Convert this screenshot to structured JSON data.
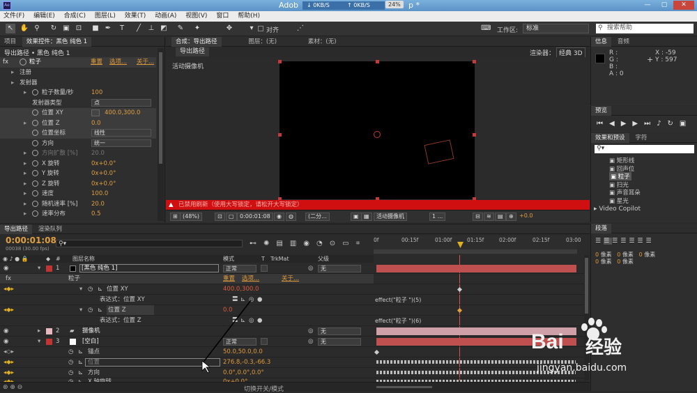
{
  "titlebar": {
    "app": "Adob",
    "net_down": "0KB/S",
    "net_up": "0KB/S",
    "net_pct": "24%",
    "title_rest": "p *",
    "min": "—",
    "max": "▢",
    "close": "✕"
  },
  "menu": [
    "文件(F)",
    "编辑(E)",
    "合成(C)",
    "图层(L)",
    "效果(T)",
    "动画(A)",
    "视图(V)",
    "窗口",
    "帮助(H)"
  ],
  "toolbar": {
    "align_label": "对齐",
    "workspace_label": "工作区:",
    "workspace_value": "标准",
    "search_placeholder": "搜索帮助"
  },
  "effect_controls": {
    "tabs": [
      "项目",
      "效果控件：黑色 纯色 1"
    ],
    "breadcrumb": "导出路径 • 黑色 纯色 1",
    "effect_name": "粒子",
    "reset": "重置",
    "options": "选项...",
    "about": "关于...",
    "rows": [
      {
        "label": "注册",
        "val": ""
      },
      {
        "label": "发射器",
        "val": ""
      },
      {
        "label": "粒子数量/秒",
        "val": "100"
      },
      {
        "label": "发射器类型",
        "val": "点",
        "dd": true
      },
      {
        "label": "位置 XY",
        "val": "400.0,300.0"
      },
      {
        "label": "位置 Z",
        "val": "0.0"
      },
      {
        "label": "位置坐标",
        "val": "线性",
        "dd": true
      },
      {
        "label": "方向",
        "val": "统一",
        "dd": true
      },
      {
        "label": "方向扩散 [%]",
        "val": "20.0"
      },
      {
        "label": "X 旋转",
        "val": "0x+0.0°"
      },
      {
        "label": "Y 旋转",
        "val": "0x+0.0°"
      },
      {
        "label": "Z 旋转",
        "val": "0x+0.0°"
      },
      {
        "label": "速度",
        "val": "100.0"
      },
      {
        "label": "随机速率 [%]",
        "val": "20.0"
      },
      {
        "label": "速率分布",
        "val": "0.5"
      }
    ]
  },
  "composition": {
    "tabs": [
      "合成：导出路径",
      "图层：(无)",
      "素材：(无)"
    ],
    "subtab": "导出路径",
    "renderer_label": "渲染器：",
    "renderer_value": "经典 3D",
    "camera_label": "活动摄像机",
    "warning": "已禁用刷新（使用大写锁定，请松开大写锁定）",
    "zoom": "(48%)",
    "timecode": "0:00:01:08",
    "resolution": "(二分...",
    "view_camera": "活动摄像机",
    "views": "1 ...",
    "exposure": "+0.0"
  },
  "info": {
    "tabs": [
      "信息",
      "音频"
    ],
    "r": "R :",
    "g": "G :",
    "b": "B :",
    "a": "A : 0",
    "x": "X : -59",
    "y": "Y : 597"
  },
  "preview": {
    "tab": "预览"
  },
  "effects_presets": {
    "tabs": [
      "效果和预设",
      "字符"
    ],
    "items": [
      "矩形线",
      "回声位",
      "粒子",
      "扫光",
      "声音耳朵",
      "星光"
    ],
    "folder": "Video Copilot"
  },
  "paragraph": {
    "tab": "段落",
    "unit": "像素",
    "val": "0"
  },
  "timeline": {
    "tabs": [
      "导出路径",
      "渲染队列"
    ],
    "timecode": "0:00:01:08",
    "fps": "00038 (30.00 fps)",
    "col_layer": "图层名称",
    "col_mode": "模式",
    "col_t": "T",
    "col_trkmat": "TrkMat",
    "col_parent": "父级",
    "ruler": [
      "0f",
      "00:15f",
      "01:00f",
      "01:15f",
      "02:00f",
      "02:15f",
      "03:00"
    ],
    "layer1": {
      "num": "1",
      "name": "[黑色 纯色 1]",
      "mode": "正常",
      "parent": "无"
    },
    "effect_row": {
      "fx": "fx",
      "name": "粒子",
      "reset": "重置",
      "options": "选项...",
      "about": "关于..."
    },
    "pos_xy": {
      "name": "位置 XY",
      "val": "400.0,300.0"
    },
    "expr1": {
      "label": "表达式：位置 XY",
      "text": "effect(\"粒子     \")(5)"
    },
    "pos_z": {
      "name": "位置 Z",
      "val": "0.0"
    },
    "expr2": {
      "label": "表达式：位置 Z",
      "text": "effect(\"粒子     \")(6)"
    },
    "layer2": {
      "num": "2",
      "name": "摄像机",
      "parent": "无"
    },
    "layer3": {
      "num": "3",
      "name": "[空白]",
      "mode": "正常",
      "parent": "无"
    },
    "anchor": {
      "name": "锚点",
      "val": "50.0,50.0,0.0"
    },
    "position": {
      "name": "位置",
      "val": "276.8,-0.3,-66.3"
    },
    "orientation": {
      "name": "方向",
      "val": "0.0°,0.0°,0.0°"
    },
    "xrot": {
      "name": "X 轴旋转",
      "val": "0x+0.0°"
    },
    "footer": "切换开关/模式"
  },
  "watermark": {
    "brand": "Bai",
    "brand2": "经验",
    "url": "jingyan.baidu.com"
  }
}
